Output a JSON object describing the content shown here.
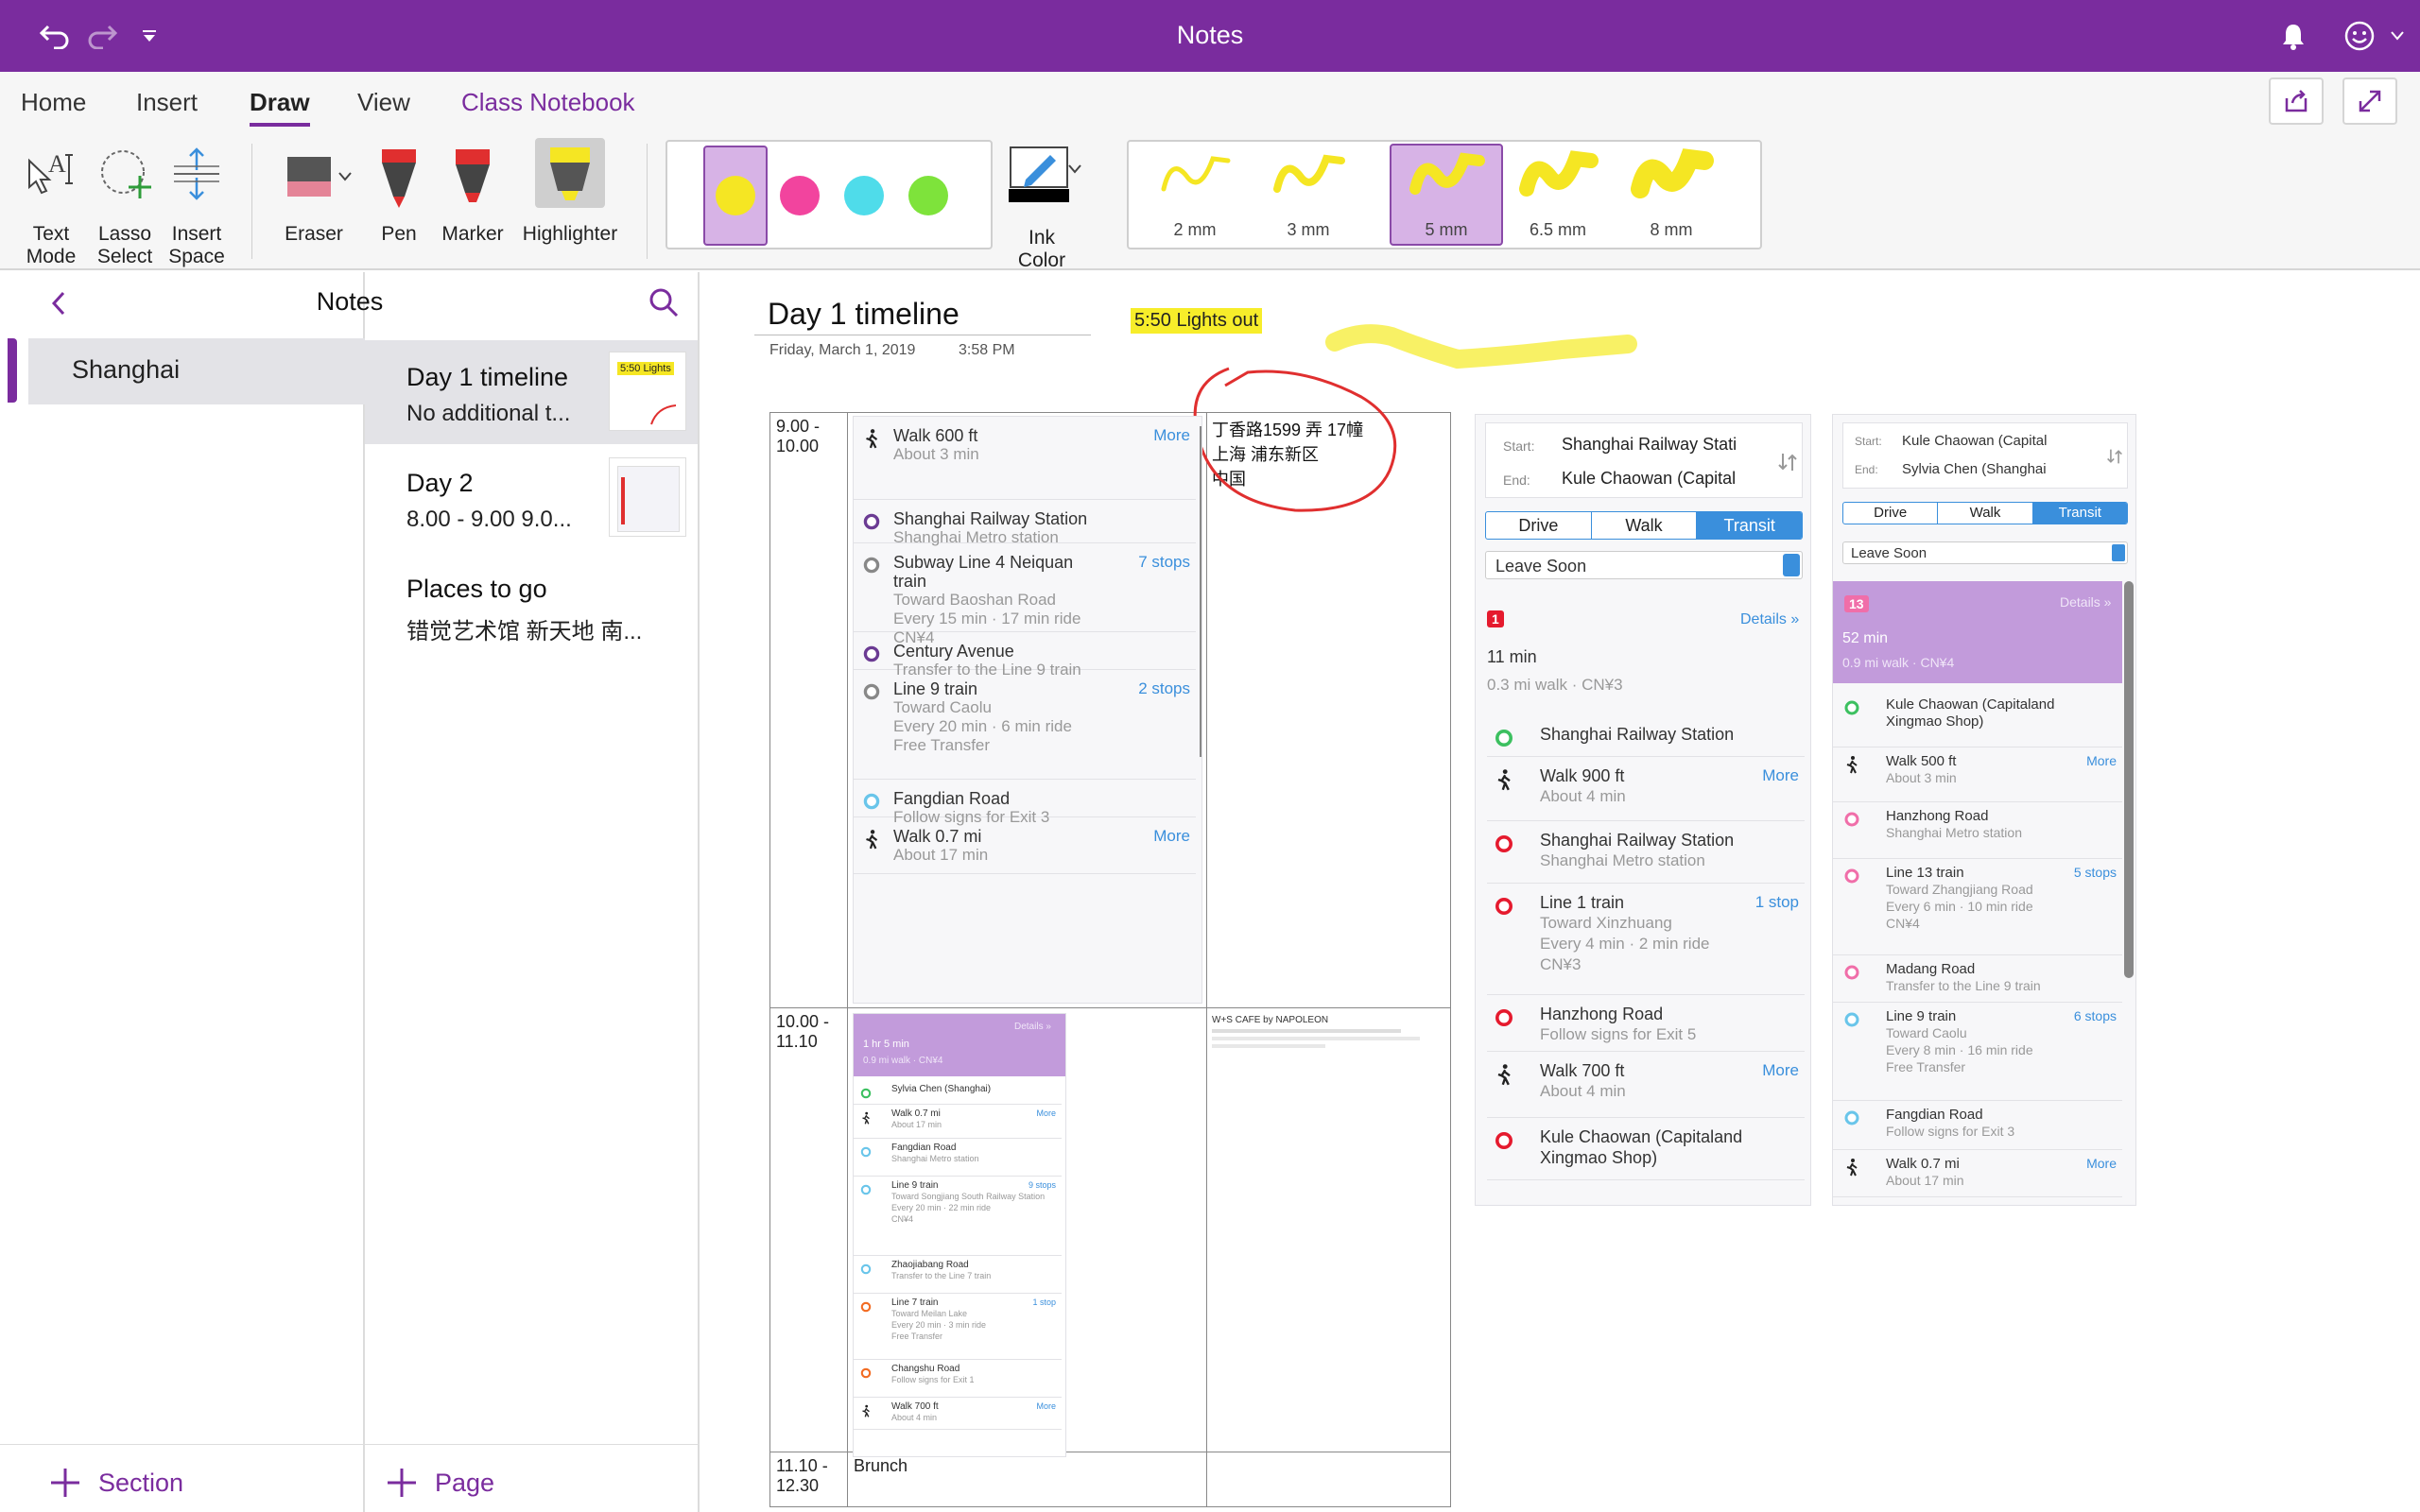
{
  "app": {
    "title": "Notes"
  },
  "tabs": [
    "Home",
    "Insert",
    "Draw",
    "View",
    "Class Notebook"
  ],
  "ribbon": {
    "tools": [
      "Text Mode",
      "Lasso Select",
      "Insert Space",
      "Eraser",
      "Pen",
      "Marker",
      "Highlighter"
    ],
    "text_mode_l1": "Text",
    "text_mode_l2": "Mode",
    "lasso_l1": "Lasso",
    "lasso_l2": "Select",
    "space_l1": "Insert",
    "space_l2": "Space",
    "eraser": "Eraser",
    "pen": "Pen",
    "marker": "Marker",
    "highlighter": "Highlighter",
    "ink_l1": "Ink",
    "ink_l2": "Color",
    "thickness": [
      "2 mm",
      "3 mm",
      "5 mm",
      "6.5 mm",
      "8 mm"
    ],
    "colors": {
      "yellow": "#f5e623",
      "pink": "#f2449e",
      "cyan": "#4fdcea",
      "green": "#7ee33b",
      "accent": "#7a2c9e"
    }
  },
  "nav": {
    "header": "Notes"
  },
  "sections": {
    "items": [
      "Shanghai"
    ],
    "add_label": "Section"
  },
  "pages": {
    "items": [
      {
        "title": "Day 1 timeline",
        "subtitle": "No additional t..."
      },
      {
        "title": "Day 2",
        "subtitle": "8.00 - 9.00  9.0..."
      },
      {
        "title": "Places to go",
        "subtitle": "错觉艺术馆  新天地  南..."
      }
    ],
    "thumb_badge": "5:50 Lights",
    "add_label": "Page"
  },
  "page": {
    "title": "Day 1 timeline",
    "date": "Friday, March 1, 2019",
    "time": "3:58 PM",
    "highlight_note": "5:50 Lights out",
    "address": [
      "丁香路1599 弄 17幢",
      "上海 浦东新区",
      "中国"
    ],
    "brunch": "Brunch",
    "cafe_name": "W+S CAFE by NAPOLEON",
    "times": [
      {
        "from": "9.00 -",
        "to": "10.00"
      },
      {
        "from": "10.00 -",
        "to": "11.10"
      },
      {
        "from": "11.10 -",
        "to": "12.30"
      }
    ]
  },
  "route1": {
    "steps": [
      {
        "a": "Walk 600 ft",
        "b": "About 3 min",
        "r": "More"
      },
      {
        "a": "Shanghai Railway Station",
        "b": "Shanghai Metro station",
        "r": ""
      },
      {
        "a": "Subway Line 4 Neiquan",
        "a2": "train",
        "b": "Toward Baoshan Road",
        "b2": "Every 15 min · 17 min ride",
        "b3": "CN¥4",
        "r": "7 stops"
      },
      {
        "a": "Century Avenue",
        "b": "Transfer to the Line 9 train",
        "r": ""
      },
      {
        "a": "Line 9 train",
        "b": "Toward Caolu",
        "b2": "Every 20 min · 6 min ride",
        "b3": "Free Transfer",
        "r": "2 stops"
      },
      {
        "a": "Fangdian Road",
        "b": "Follow signs for Exit 3",
        "r": ""
      },
      {
        "a": "Walk 0.7 mi",
        "b": "About 17 min",
        "r": "More"
      }
    ]
  },
  "route2": {
    "summary": {
      "time": "1 hr 5 min",
      "meta": "0.9 mi walk · CN¥4",
      "details": "Details »"
    },
    "steps": [
      {
        "a": "Sylvia Chen (Shanghai)",
        "b": "",
        "r": ""
      },
      {
        "a": "Walk 0.7 mi",
        "b": "About 17 min",
        "r": "More"
      },
      {
        "a": "Fangdian Road",
        "b": "Shanghai Metro station",
        "r": ""
      },
      {
        "a": "Line 9 train",
        "b": "Toward Songjiang South Railway Station",
        "b2": "Every 20 min · 22 min ride",
        "b3": "CN¥4",
        "r": "9 stops"
      },
      {
        "a": "Zhaojiabang Road",
        "b": "Transfer to the Line 7 train",
        "r": ""
      },
      {
        "a": "Line 7 train",
        "b": "Toward Meilan Lake",
        "b2": "Every 20 min · 3 min ride",
        "b3": "Free Transfer",
        "r": "1 stop"
      },
      {
        "a": "Changshu Road",
        "b": "Follow signs for Exit 1",
        "r": ""
      },
      {
        "a": "Walk 700 ft",
        "b": "About 4 min",
        "r": "More"
      }
    ]
  },
  "route3": {
    "start_label": "Start:",
    "start": "Shanghai Railway Stati",
    "end_label": "End:",
    "end": "Kule Chaowan (Capital",
    "modes": [
      "Drive",
      "Walk",
      "Transit"
    ],
    "leave": "Leave Soon",
    "summary": {
      "time": "11 min",
      "meta": "0.3 mi walk · CN¥3",
      "details": "Details »"
    },
    "steps": [
      {
        "a": "Shanghai Railway Station",
        "b": "",
        "r": ""
      },
      {
        "a": "Walk 900 ft",
        "b": "About 4 min",
        "r": "More"
      },
      {
        "a": "Shanghai Railway Station",
        "b": "Shanghai Metro station",
        "r": ""
      },
      {
        "a": "Line 1 train",
        "b": "Toward Xinzhuang",
        "b2": "Every 4 min · 2 min ride",
        "b3": "CN¥3",
        "r": "1 stop"
      },
      {
        "a": "Hanzhong Road",
        "b": "Follow signs for Exit 5",
        "r": ""
      },
      {
        "a": "Walk 700 ft",
        "b": "About 4 min",
        "r": "More"
      },
      {
        "a": "Kule Chaowan (Capitaland",
        "a2": "Xingmao Shop)",
        "b": "",
        "r": ""
      }
    ]
  },
  "route4": {
    "start_label": "Start:",
    "start": "Kule Chaowan (Capital",
    "end_label": "End:",
    "end": "Sylvia Chen (Shanghai",
    "modes": [
      "Drive",
      "Walk",
      "Transit"
    ],
    "leave": "Leave Soon",
    "summary": {
      "time": "52 min",
      "meta": "0.9 mi walk · CN¥4",
      "details": "Details »"
    },
    "steps": [
      {
        "a": "Kule Chaowan (Capitaland",
        "a2": "Xingmao Shop)",
        "b": "",
        "r": ""
      },
      {
        "a": "Walk 500 ft",
        "b": "About 3 min",
        "r": "More"
      },
      {
        "a": "Hanzhong Road",
        "b": "Shanghai Metro station",
        "r": ""
      },
      {
        "a": "Line 13 train",
        "b": "Toward Zhangjiang Road",
        "b2": "Every 6 min · 10 min ride",
        "b3": "CN¥4",
        "r": "5 stops"
      },
      {
        "a": "Madang Road",
        "b": "Transfer to the Line 9 train",
        "r": ""
      },
      {
        "a": "Line 9 train",
        "b": "Toward Caolu",
        "b2": "Every 8 min · 16 min ride",
        "b3": "Free Transfer",
        "r": "6 stops"
      },
      {
        "a": "Fangdian Road",
        "b": "Follow signs for Exit 3",
        "r": ""
      },
      {
        "a": "Walk 0.7 mi",
        "b": "About 17 min",
        "r": "More"
      }
    ]
  }
}
